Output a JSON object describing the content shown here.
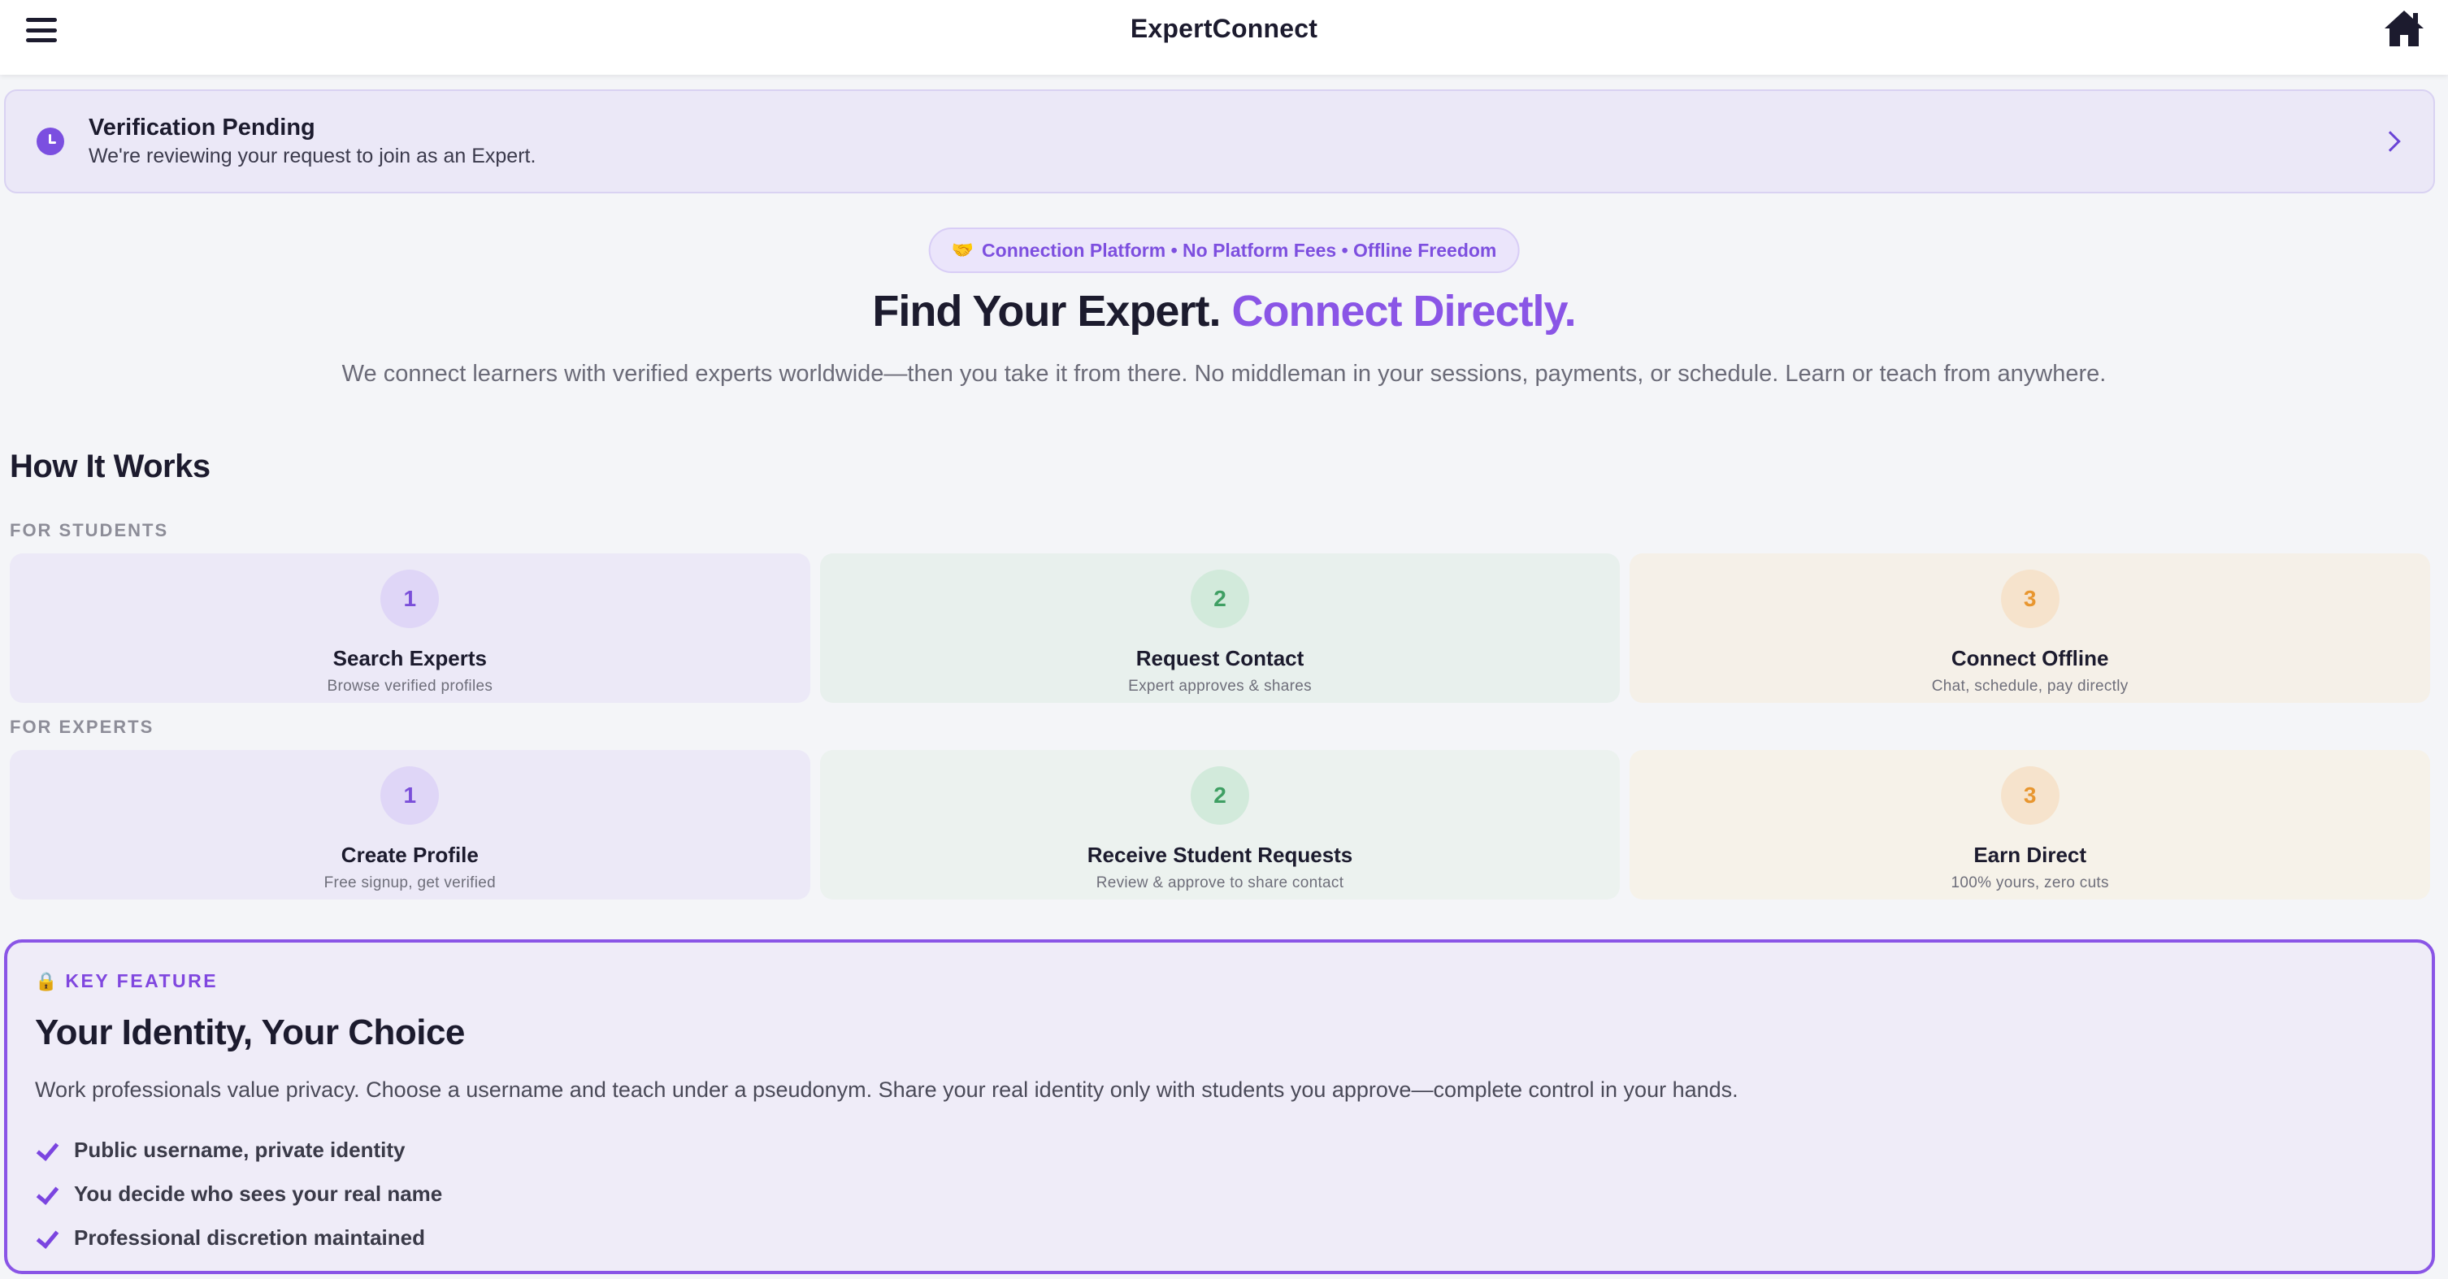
{
  "header": {
    "title": "ExpertConnect",
    "menu_icon": "menu-icon",
    "home_icon": "home-icon"
  },
  "verification": {
    "title": "Verification Pending",
    "subtitle": "We're reviewing your request to join as an Expert.",
    "icon": "clock-icon"
  },
  "hero": {
    "pill_emoji": "🤝",
    "pill_text": "Connection Platform • No Platform Fees • Offline Freedom",
    "title_main": "Find Your Expert.",
    "title_accent": "Connect Directly.",
    "subtitle": "We connect learners with verified experts worldwide—then you take it from there. No middleman in your sessions, payments, or schedule. Learn or teach from anywhere."
  },
  "how_it_works": {
    "title": "How It Works",
    "students": {
      "label": "FOR STUDENTS",
      "steps": [
        {
          "num": "1",
          "title": "Search Experts",
          "sub": "Browse verified profiles"
        },
        {
          "num": "2",
          "title": "Request Contact",
          "sub": "Expert approves & shares"
        },
        {
          "num": "3",
          "title": "Connect Offline",
          "sub": "Chat, schedule, pay directly"
        }
      ]
    },
    "experts": {
      "label": "FOR EXPERTS",
      "steps": [
        {
          "num": "1",
          "title": "Create Profile",
          "sub": "Free signup, get verified"
        },
        {
          "num": "2",
          "title": "Receive Student Requests",
          "sub": "Review & approve to share contact"
        },
        {
          "num": "3",
          "title": "Earn Direct",
          "sub": "100% yours, zero cuts"
        }
      ]
    }
  },
  "feature": {
    "badge_emoji": "🔒",
    "badge": "KEY FEATURE",
    "title": "Your Identity, Your Choice",
    "description": "Work professionals value privacy. Choose a username and teach under a pseudonym. Share your real identity only with students you approve—complete control in your hands.",
    "items": [
      "Public username, private identity",
      "You decide who sees your real name",
      "Professional discretion maintained"
    ]
  },
  "colors": {
    "accent": "#8a55e6",
    "step1": "#7a4fd9",
    "step2": "#3f9f63",
    "step3": "#e8962f"
  }
}
